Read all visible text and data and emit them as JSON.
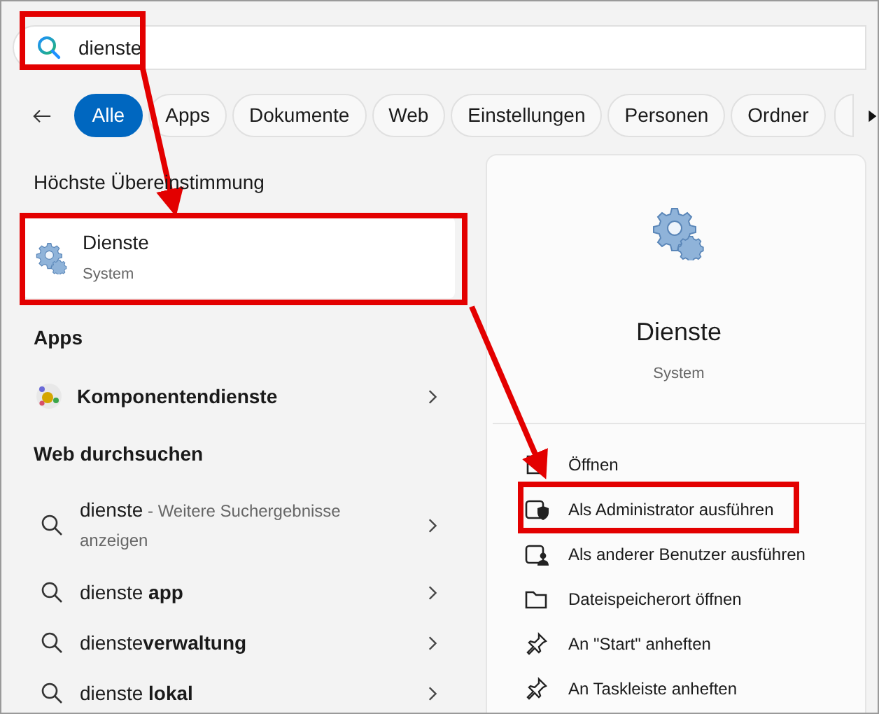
{
  "search": {
    "value": "dienste"
  },
  "filters": [
    {
      "label": "Alle",
      "selected": true
    },
    {
      "label": "Apps",
      "selected": false
    },
    {
      "label": "Dokumente",
      "selected": false
    },
    {
      "label": "Web",
      "selected": false
    },
    {
      "label": "Einstellungen",
      "selected": false
    },
    {
      "label": "Personen",
      "selected": false
    },
    {
      "label": "Ordner",
      "selected": false
    }
  ],
  "best_match": {
    "heading": "Höchste Übereinstimmung",
    "title": "Dienste",
    "subtitle": "System"
  },
  "apps": {
    "heading": "Apps",
    "items": [
      {
        "label": "Komponentendienste"
      }
    ]
  },
  "web": {
    "heading": "Web durchsuchen",
    "items": [
      {
        "text": "dienste",
        "hint": "- Weitere Suchergebnisse anzeigen"
      },
      {
        "text": "dienste **app**"
      },
      {
        "text": "dienste**verwaltung**"
      },
      {
        "text": "dienste **lokal**"
      }
    ]
  },
  "detail": {
    "title": "Dienste",
    "subtitle": "System",
    "actions": [
      {
        "kind": "open",
        "label": "Öffnen"
      },
      {
        "kind": "admin",
        "label": "Als Administrator ausführen"
      },
      {
        "kind": "user",
        "label": "Als anderer Benutzer ausführen"
      },
      {
        "kind": "folder",
        "label": "Dateispeicherort öffnen"
      },
      {
        "kind": "pin",
        "label": "An \"Start\" anheften"
      },
      {
        "kind": "pin",
        "label": "An Taskleiste anheften"
      }
    ]
  }
}
